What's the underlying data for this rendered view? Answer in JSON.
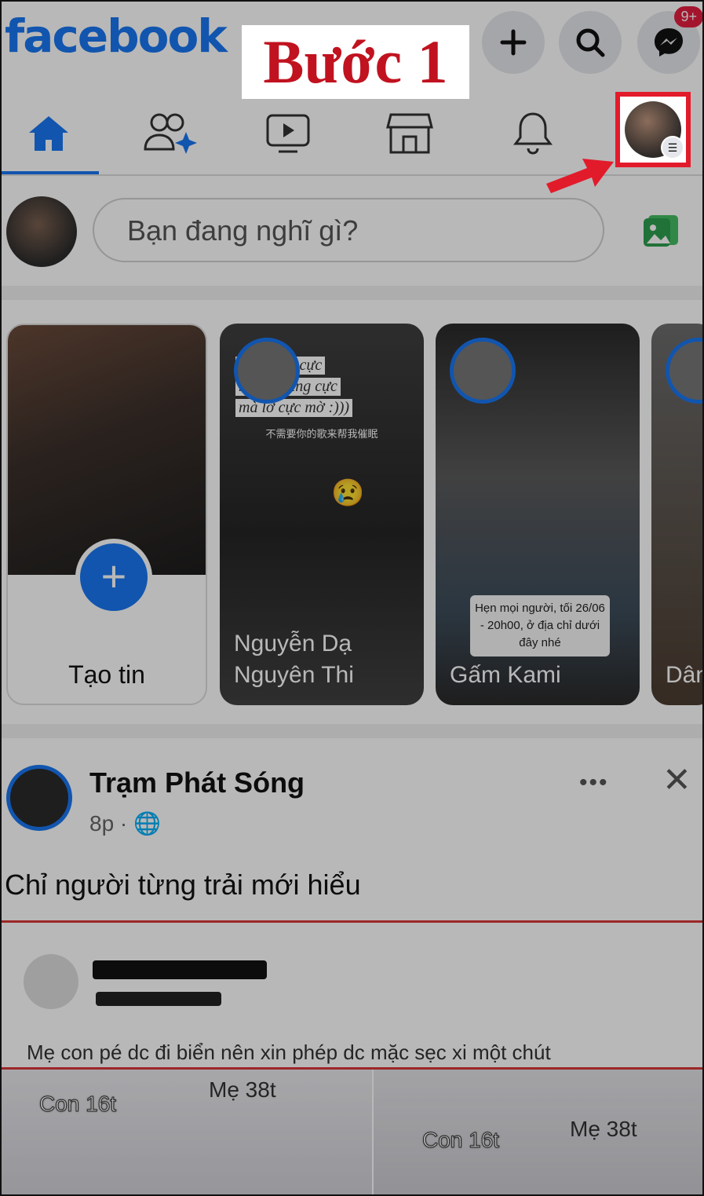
{
  "header": {
    "logo": "facebook",
    "step_label": "Bước 1",
    "messenger_badge": "9+"
  },
  "nav": {
    "items": [
      "home",
      "friends",
      "watch",
      "marketplace",
      "notifications",
      "menu"
    ],
    "active": "home"
  },
  "composer": {
    "placeholder": "Bạn đang nghĩ gì?"
  },
  "stories": [
    {
      "label": "Tạo tin"
    },
    {
      "name": "Nguyễn Dạ Nguyên Thi",
      "overlay": [
        "cũng cực cực",
        "m nay cũng cực",
        "mà lỡ cực mờ :)))"
      ],
      "caption_cn": "不需要你的歌来帮我催眠"
    },
    {
      "name": "Gấm Kami",
      "caption": "Hẹn mọi người, tối 26/06 - 20h00, ở địa chỉ dưới đây nhé"
    },
    {
      "name": "Dân"
    }
  ],
  "post": {
    "page_name": "Trạm Phát Sóng",
    "time": "8p ·",
    "text": "Chỉ người từng trải mới hiểu",
    "shared_text": "Mẹ con pé dc đi biển nên xin phép dc mặc sẹc xi một chút",
    "image_tags": [
      "Con 16t",
      "Mẹ 38t",
      "Con 16t",
      "Mẹ 38t"
    ]
  },
  "colors": {
    "brand": "#1877f2",
    "annotation": "#e21b2a"
  }
}
